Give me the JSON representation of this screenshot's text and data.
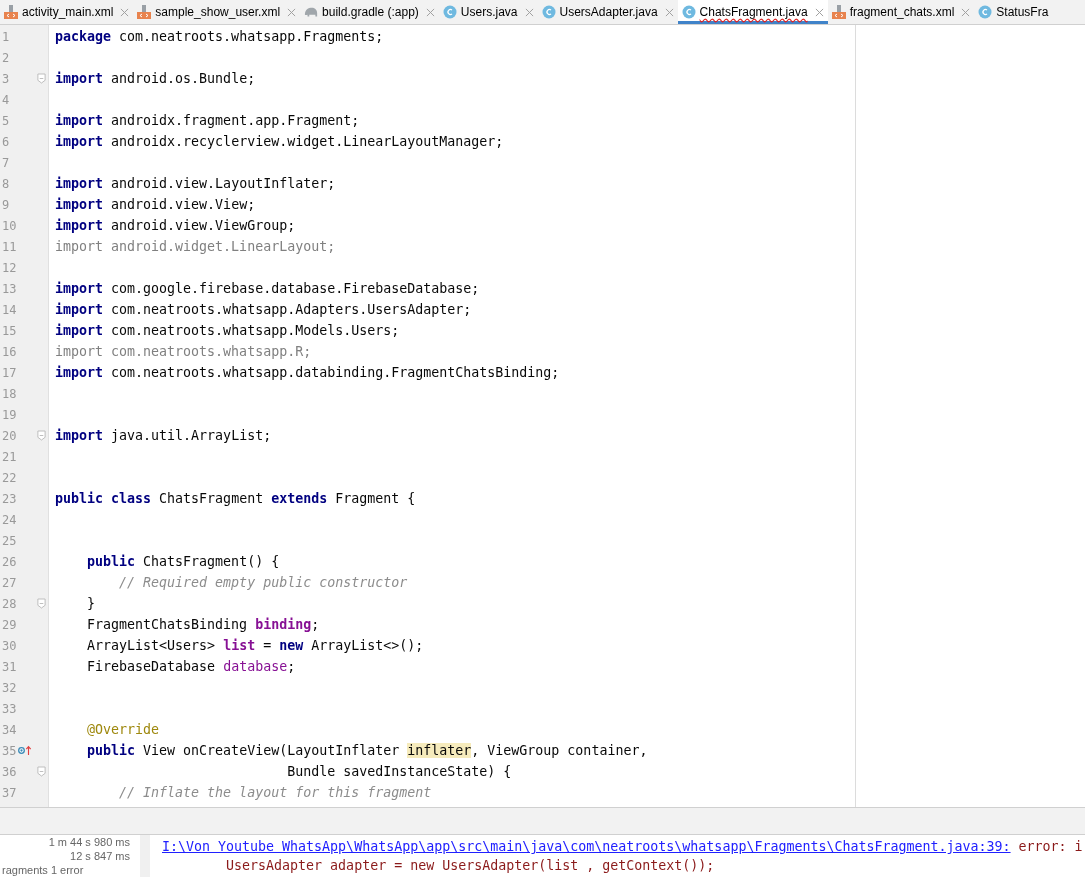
{
  "tabs": [
    {
      "label": "activity_main.xml",
      "kind": "xml",
      "selected": false,
      "error": false,
      "closable": true
    },
    {
      "label": "sample_show_user.xml",
      "kind": "xml",
      "selected": false,
      "error": false,
      "closable": true
    },
    {
      "label": "build.gradle (:app)",
      "kind": "gradle",
      "selected": false,
      "error": false,
      "closable": true
    },
    {
      "label": "Users.java",
      "kind": "class",
      "selected": false,
      "error": false,
      "closable": true
    },
    {
      "label": "UsersAdapter.java",
      "kind": "class",
      "selected": false,
      "error": false,
      "closable": true
    },
    {
      "label": "ChatsFragment.java",
      "kind": "class",
      "selected": true,
      "error": true,
      "closable": true
    },
    {
      "label": "fragment_chats.xml",
      "kind": "xml",
      "selected": false,
      "error": false,
      "closable": true
    },
    {
      "label": "StatusFra",
      "kind": "class",
      "selected": false,
      "error": false,
      "closable": false
    }
  ],
  "editor": {
    "lines": [
      {
        "num": "1",
        "kind": "plain",
        "tokens": [
          {
            "t": "package ",
            "kind": "kw"
          },
          {
            "t": "com.neatroots.whatsapp.Fragments;",
            "kind": "plain"
          }
        ]
      },
      {
        "num": "2",
        "kind": "plain"
      },
      {
        "num": "3",
        "kind": "fold",
        "tokens": [
          {
            "t": "import ",
            "kind": "kw"
          },
          {
            "t": "android.os.Bundle;",
            "kind": "plain"
          }
        ]
      },
      {
        "num": "4",
        "kind": "plain"
      },
      {
        "num": "5",
        "kind": "plain",
        "tokens": [
          {
            "t": "import ",
            "kind": "kw"
          },
          {
            "t": "androidx.fragment.app.Fragment;",
            "kind": "plain"
          }
        ]
      },
      {
        "num": "6",
        "kind": "plain",
        "tokens": [
          {
            "t": "import ",
            "kind": "kw"
          },
          {
            "t": "androidx.recyclerview.widget.LinearLayoutManager;",
            "kind": "plain"
          }
        ]
      },
      {
        "num": "7",
        "kind": "plain"
      },
      {
        "num": "8",
        "kind": "plain",
        "tokens": [
          {
            "t": "import ",
            "kind": "kw"
          },
          {
            "t": "android.view.LayoutInflater;",
            "kind": "plain"
          }
        ]
      },
      {
        "num": "9",
        "kind": "plain",
        "tokens": [
          {
            "t": "import ",
            "kind": "kw"
          },
          {
            "t": "android.view.View;",
            "kind": "plain"
          }
        ]
      },
      {
        "num": "10",
        "kind": "plain",
        "tokens": [
          {
            "t": "import ",
            "kind": "kw"
          },
          {
            "t": "android.view.ViewGroup;",
            "kind": "plain"
          }
        ]
      },
      {
        "num": "11",
        "kind": "plain",
        "tokens": [
          {
            "t": "import android.widget.LinearLayout;",
            "kind": "unused"
          }
        ]
      },
      {
        "num": "12",
        "kind": "plain"
      },
      {
        "num": "13",
        "kind": "plain",
        "tokens": [
          {
            "t": "import ",
            "kind": "kw"
          },
          {
            "t": "com.google.firebase.database.FirebaseDatabase;",
            "kind": "plain"
          }
        ]
      },
      {
        "num": "14",
        "kind": "plain",
        "tokens": [
          {
            "t": "import ",
            "kind": "kw"
          },
          {
            "t": "com.neatroots.whatsapp.Adapters.UsersAdapter;",
            "kind": "plain"
          }
        ]
      },
      {
        "num": "15",
        "kind": "plain",
        "tokens": [
          {
            "t": "import ",
            "kind": "kw"
          },
          {
            "t": "com.neatroots.whatsapp.Models.Users;",
            "kind": "plain"
          }
        ]
      },
      {
        "num": "16",
        "kind": "plain",
        "tokens": [
          {
            "t": "import com.neatroots.whatsapp.R;",
            "kind": "unused"
          }
        ]
      },
      {
        "num": "17",
        "kind": "plain",
        "tokens": [
          {
            "t": "import ",
            "kind": "kw"
          },
          {
            "t": "com.neatroots.whatsapp.databinding.FragmentChatsBinding;",
            "kind": "plain"
          }
        ]
      },
      {
        "num": "18",
        "kind": "plain"
      },
      {
        "num": "19",
        "kind": "plain"
      },
      {
        "num": "20",
        "kind": "fold",
        "tokens": [
          {
            "t": "import ",
            "kind": "kw"
          },
          {
            "t": "java.util.ArrayList;",
            "kind": "plain"
          }
        ]
      },
      {
        "num": "21",
        "kind": "plain"
      },
      {
        "num": "22",
        "kind": "plain"
      },
      {
        "num": "23",
        "kind": "plain",
        "tokens": [
          {
            "t": "public class ",
            "kind": "kw"
          },
          {
            "t": "ChatsFragment ",
            "kind": "plain"
          },
          {
            "t": "extends ",
            "kind": "kw"
          },
          {
            "t": "Fragment {",
            "kind": "plain"
          }
        ]
      },
      {
        "num": "24",
        "kind": "plain"
      },
      {
        "num": "25",
        "kind": "plain"
      },
      {
        "num": "26",
        "kind": "plain",
        "tokens": [
          {
            "t": "    public ",
            "kind": "kw"
          },
          {
            "t": "ChatsFragment() {",
            "kind": "plain"
          }
        ]
      },
      {
        "num": "27",
        "kind": "plain",
        "tokens": [
          {
            "t": "        // Required empty public constructor",
            "kind": "comment"
          }
        ]
      },
      {
        "num": "28",
        "kind": "fold",
        "tokens": [
          {
            "t": "    }",
            "kind": "plain"
          }
        ]
      },
      {
        "num": "29",
        "kind": "plain",
        "tokens": [
          {
            "t": "    FragmentChatsBinding ",
            "kind": "plain"
          },
          {
            "t": "binding",
            "kind": "field"
          },
          {
            "t": ";",
            "kind": "plain"
          }
        ]
      },
      {
        "num": "30",
        "kind": "plain",
        "tokens": [
          {
            "t": "    ArrayList<Users> ",
            "kind": "plain"
          },
          {
            "t": "list ",
            "kind": "field"
          },
          {
            "t": "= ",
            "kind": "plain"
          },
          {
            "t": "new ",
            "kind": "kw"
          },
          {
            "t": "ArrayList<>();",
            "kind": "plain"
          }
        ]
      },
      {
        "num": "31",
        "kind": "plain",
        "tokens": [
          {
            "t": "    FirebaseDatabase ",
            "kind": "plain"
          },
          {
            "t": "database",
            "kind": "fieldlight"
          },
          {
            "t": ";",
            "kind": "plain"
          }
        ]
      },
      {
        "num": "32",
        "kind": "plain"
      },
      {
        "num": "33",
        "kind": "plain"
      },
      {
        "num": "34",
        "kind": "plain",
        "tokens": [
          {
            "t": "    @Override",
            "kind": "annot"
          }
        ]
      },
      {
        "num": "35",
        "kind": "override",
        "tokens": [
          {
            "t": "    public ",
            "kind": "kw"
          },
          {
            "t": "View onCreateView(LayoutInflater ",
            "kind": "plain"
          },
          {
            "t": "inflater",
            "kind": "hl"
          },
          {
            "t": ", ViewGroup container,",
            "kind": "plain"
          }
        ]
      },
      {
        "num": "36",
        "kind": "fold",
        "tokens": [
          {
            "t": "                             Bundle savedInstanceState) {",
            "kind": "plain"
          }
        ]
      },
      {
        "num": "37",
        "kind": "plain",
        "tokens": [
          {
            "t": "        // Inflate the layout for this fragment",
            "kind": "comment"
          }
        ]
      }
    ]
  },
  "build": {
    "times": [
      "1 m 44 s 980 ms",
      "12 s 847 ms",
      "ragments 1 error"
    ],
    "output": {
      "link": "I:\\Von Youtube WhatsApp\\WhatsApp\\app\\src\\main\\java\\com\\neatroots\\whatsapp\\Fragments\\ChatsFragment.java:39:",
      "message": " error: i",
      "code": "        UsersAdapter adapter = new UsersAdapter(list , getContext());"
    }
  }
}
